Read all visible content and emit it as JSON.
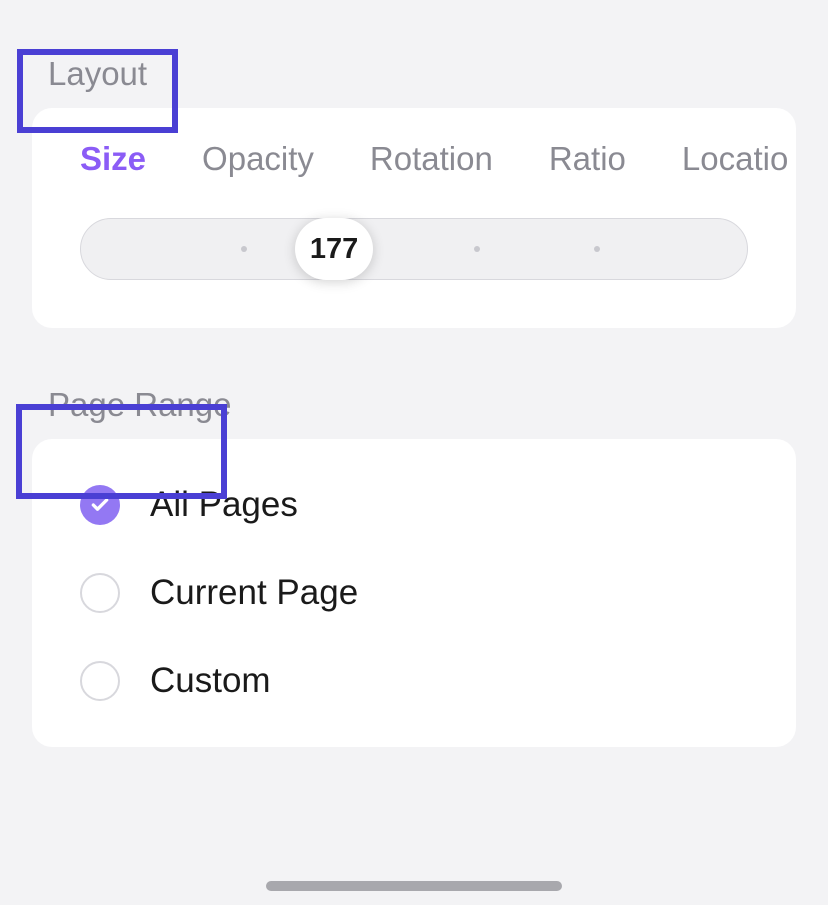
{
  "sections": {
    "layout": {
      "title": "Layout",
      "tabs": [
        {
          "label": "Size",
          "active": true
        },
        {
          "label": "Opacity",
          "active": false
        },
        {
          "label": "Rotation",
          "active": false
        },
        {
          "label": "Ratio",
          "active": false
        },
        {
          "label": "Locatio",
          "active": false
        }
      ],
      "slider": {
        "value": "177"
      }
    },
    "pageRange": {
      "title": "Page Range",
      "options": [
        {
          "label": "All Pages",
          "selected": true
        },
        {
          "label": "Current Page",
          "selected": false
        },
        {
          "label": "Custom",
          "selected": false
        }
      ]
    }
  }
}
